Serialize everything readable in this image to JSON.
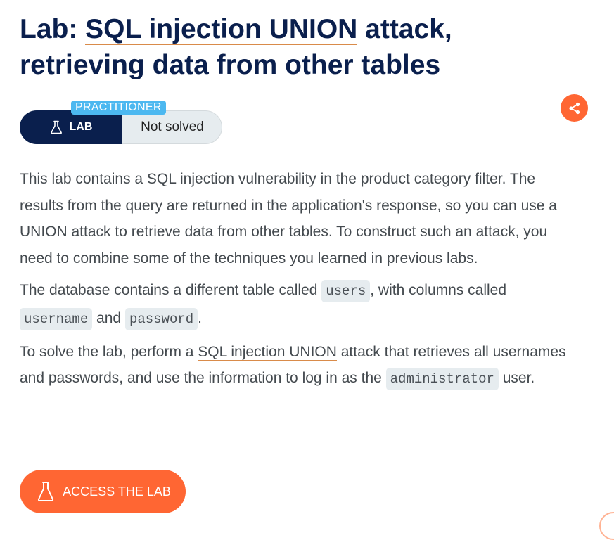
{
  "title": {
    "prefix": "Lab: ",
    "link_text": "SQL injection UNION",
    "suffix": " attack, retrieving data from other tables"
  },
  "status": {
    "level_badge": "PRACTITIONER",
    "lab_label": "LAB",
    "state": "Not solved"
  },
  "description": {
    "p1": "This lab contains a SQL injection vulnerability in the product category filter. The results from the query are returned in the application's response, so you can use a UNION attack to retrieve data from other tables. To construct such an attack, you need to combine some of the techniques you learned in previous labs.",
    "p2_a": "The database contains a different table called ",
    "p2_code1": "users",
    "p2_b": ", with columns called ",
    "p2_code2": "username",
    "p2_c": " and ",
    "p2_code3": "password",
    "p2_d": ".",
    "p3_a": "To solve the lab, perform a ",
    "p3_link": "SQL injection UNION",
    "p3_b": " attack that retrieves all usernames and passwords, and use the information to log in as the ",
    "p3_code": "administrator",
    "p3_c": " user."
  },
  "actions": {
    "access_label": "ACCESS THE LAB"
  },
  "icons": {
    "share": "share-icon",
    "flask": "flask-icon"
  },
  "colors": {
    "navy": "#0a1f4d",
    "accent_orange": "#ff6633",
    "badge_blue": "#4cb8f0",
    "chip_bg": "#e6ecef",
    "body_text": "#444a4f"
  }
}
